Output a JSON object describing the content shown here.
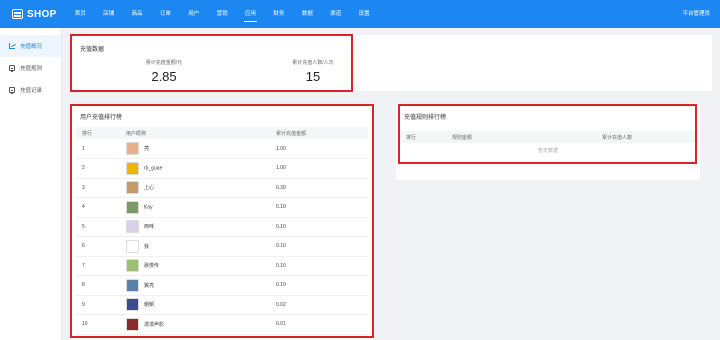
{
  "header": {
    "logo": "SHOP",
    "nav": [
      "首页",
      "店铺",
      "商品",
      "订单",
      "用户",
      "营销",
      "应用",
      "财务",
      "数据",
      "渠道",
      "设置"
    ],
    "active_nav": "应用",
    "admin": "平台管理员"
  },
  "sidebar": {
    "items": [
      {
        "label": "充值概况",
        "icon": "chart-icon",
        "active": true
      },
      {
        "label": "充值规则",
        "icon": "document-icon",
        "active": false
      },
      {
        "label": "充值记录",
        "icon": "document-icon",
        "active": false
      }
    ]
  },
  "overview": {
    "title": "充值数据",
    "stats": [
      {
        "label": "累计充值金额/元",
        "value": "2.85"
      },
      {
        "label": "累计充值人数/人次",
        "value": "15"
      }
    ]
  },
  "user_rank": {
    "title": "用户充值排行榜",
    "columns": [
      "排行",
      "用户昵称",
      "累计充值金额"
    ],
    "rows": [
      {
        "rank": "1",
        "name": "亮",
        "amount": "1.00"
      },
      {
        "rank": "2",
        "name": "rb_guae",
        "amount": "1.00"
      },
      {
        "rank": "3",
        "name": "上心",
        "amount": "0.30"
      },
      {
        "rank": "4",
        "name": "Kay",
        "amount": "0.10"
      },
      {
        "rank": "5",
        "name": "西咪",
        "amount": "0.10"
      },
      {
        "rank": "6",
        "name": "我",
        "amount": "0.10"
      },
      {
        "rank": "7",
        "name": "晨慢传",
        "amount": "0.10"
      },
      {
        "rank": "8",
        "name": "翼亮",
        "amount": "0.10"
      },
      {
        "rank": "9",
        "name": "朝朝",
        "amount": "0.02"
      },
      {
        "rank": "10",
        "name": "漫漫声影",
        "amount": "0.01"
      }
    ]
  },
  "rule_rank": {
    "title": "充值规则排行榜",
    "columns": [
      "排行",
      "规则金额",
      "累计充值人数"
    ],
    "empty": "暂无数据"
  },
  "colors": {
    "primary": "#1c87f0",
    "highlight": "#d8242d",
    "avatars": [
      "#e8b08a",
      "#f2b400",
      "#c49a6c",
      "#7a9a6a",
      "#d9d0ea",
      "#ffffff",
      "#9cbf73",
      "#5a7fa8",
      "#3d4a8f",
      "#8a2a2a"
    ]
  }
}
